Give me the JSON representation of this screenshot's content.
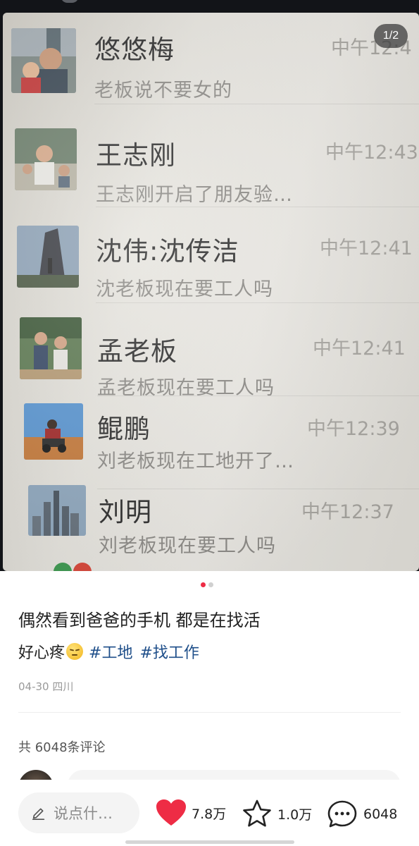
{
  "image_counter": "1/2",
  "chat_list": [
    {
      "name": "悠悠梅",
      "message": "老板说不要女的",
      "time": "中午12:4"
    },
    {
      "name": "王志刚",
      "message": "王志刚开启了朋友验…",
      "time": "中午12:43"
    },
    {
      "name": "沈伟:沈传洁",
      "message": "沈老板现在要工人吗",
      "time": "中午12:41"
    },
    {
      "name": "孟老板",
      "message": "孟老板现在要工人吗",
      "time": "中午12:41"
    },
    {
      "name": "鲲鹏",
      "message": "刘老板现在工地开了…",
      "time": "中午12:39"
    },
    {
      "name": "刘明",
      "message": "刘老板现在要工人吗",
      "time": "中午12:37"
    }
  ],
  "post": {
    "title": "偶然看到爸爸的手机 都是在找活",
    "body_text": "好心疼",
    "emoji": "pensive-face",
    "tags": [
      "#工地",
      "#找工作"
    ],
    "meta": "04-30 四川"
  },
  "comments": {
    "title": "共 6048条评论"
  },
  "bottom_bar": {
    "input_placeholder": "说点什…",
    "likes": "7.8万",
    "favorites": "1.0万",
    "comments": "6048"
  },
  "colors": {
    "accent_red": "#ee2c45",
    "tag_blue": "#1f4f8a"
  }
}
